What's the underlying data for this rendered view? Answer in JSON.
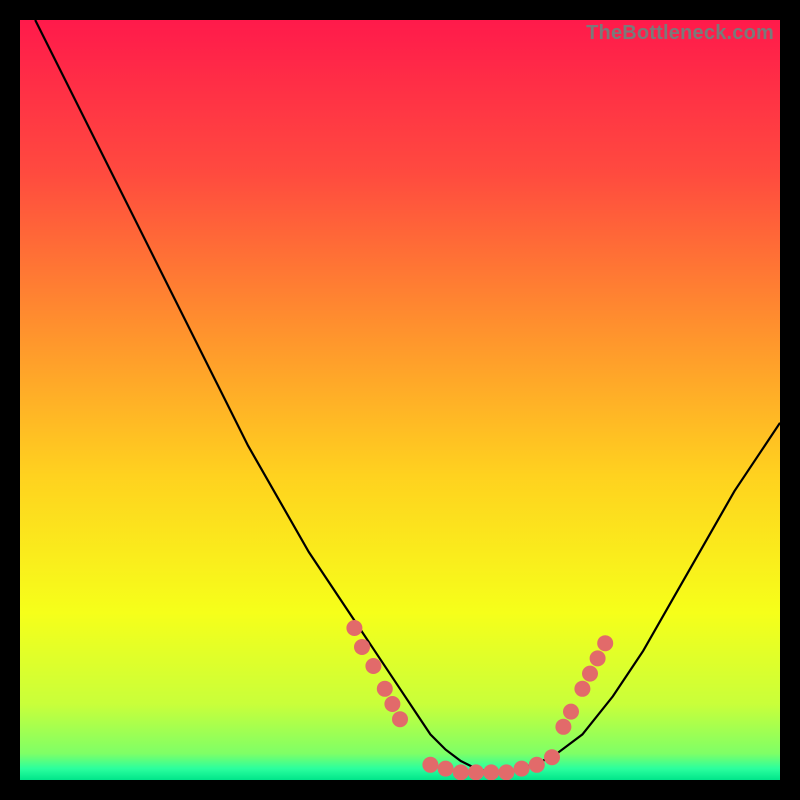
{
  "watermark": "TheBottleneck.com",
  "chart_data": {
    "type": "line",
    "title": "",
    "xlabel": "",
    "ylabel": "",
    "xlim": [
      0,
      100
    ],
    "ylim": [
      0,
      100
    ],
    "background_gradient": {
      "stops": [
        {
          "offset": 0.0,
          "color": "#ff1a4b"
        },
        {
          "offset": 0.2,
          "color": "#ff4a3f"
        },
        {
          "offset": 0.4,
          "color": "#ff8f2e"
        },
        {
          "offset": 0.6,
          "color": "#ffd21f"
        },
        {
          "offset": 0.78,
          "color": "#f6ff1a"
        },
        {
          "offset": 0.9,
          "color": "#c9ff3a"
        },
        {
          "offset": 0.965,
          "color": "#7fff66"
        },
        {
          "offset": 0.985,
          "color": "#2bff9e"
        },
        {
          "offset": 1.0,
          "color": "#00e58a"
        }
      ]
    },
    "series": [
      {
        "name": "bottleneck-curve",
        "color": "#000000",
        "x": [
          2,
          6,
          10,
          14,
          18,
          22,
          26,
          30,
          34,
          38,
          42,
          46,
          50,
          52,
          54,
          56,
          58,
          60,
          62,
          64,
          66,
          70,
          74,
          78,
          82,
          86,
          90,
          94,
          98,
          100
        ],
        "y": [
          100,
          92,
          84,
          76,
          68,
          60,
          52,
          44,
          37,
          30,
          24,
          18,
          12,
          9,
          6,
          4,
          2.5,
          1.5,
          1,
          1,
          1.5,
          3,
          6,
          11,
          17,
          24,
          31,
          38,
          44,
          47
        ]
      }
    ],
    "markers": {
      "color": "#e26a6a",
      "radius": 8,
      "points": [
        {
          "x": 44,
          "y": 20
        },
        {
          "x": 45,
          "y": 17.5
        },
        {
          "x": 46.5,
          "y": 15
        },
        {
          "x": 48,
          "y": 12
        },
        {
          "x": 49,
          "y": 10
        },
        {
          "x": 50,
          "y": 8
        },
        {
          "x": 54,
          "y": 2
        },
        {
          "x": 56,
          "y": 1.5
        },
        {
          "x": 58,
          "y": 1
        },
        {
          "x": 60,
          "y": 1
        },
        {
          "x": 62,
          "y": 1
        },
        {
          "x": 64,
          "y": 1
        },
        {
          "x": 66,
          "y": 1.5
        },
        {
          "x": 68,
          "y": 2
        },
        {
          "x": 70,
          "y": 3
        },
        {
          "x": 71.5,
          "y": 7
        },
        {
          "x": 72.5,
          "y": 9
        },
        {
          "x": 74,
          "y": 12
        },
        {
          "x": 75,
          "y": 14
        },
        {
          "x": 76,
          "y": 16
        },
        {
          "x": 77,
          "y": 18
        }
      ]
    }
  }
}
